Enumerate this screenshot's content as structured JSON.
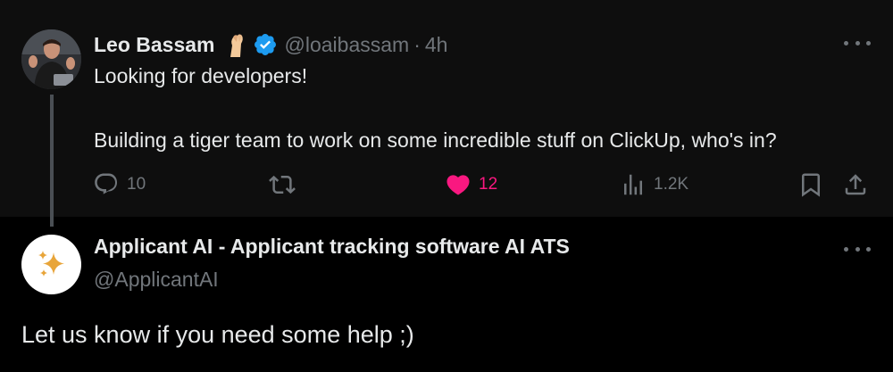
{
  "parent_tweet": {
    "author_name": "Leo Bassam",
    "handle": "@loaibassam",
    "separator": "·",
    "time": "4h",
    "text_line1": "Looking for developers!",
    "text_line2": "Building a tiger team to work on some incredible stuff on ClickUp, who's in?",
    "avatar_icon": "profile-photo",
    "emoji_icon": "pinched-fingers-emoji",
    "verified_icon": "verified-badge",
    "actions": {
      "replies": "10",
      "likes": "12",
      "views": "1.2K"
    },
    "liked": true
  },
  "reply_tweet": {
    "author_name": "Applicant AI - Applicant tracking software AI ATS",
    "handle": "@ApplicantAI",
    "text": "Let us know if you need some help ;)",
    "avatar_icon": "sparkles-logo"
  },
  "colors": {
    "background": "#000000",
    "parent_background": "#0e0e0e",
    "text_primary": "#e7e9ea",
    "text_secondary": "#71767b",
    "verified_blue": "#1d9bf0",
    "like_pink": "#f91880",
    "sparkle_gold": "#e8a53a"
  }
}
